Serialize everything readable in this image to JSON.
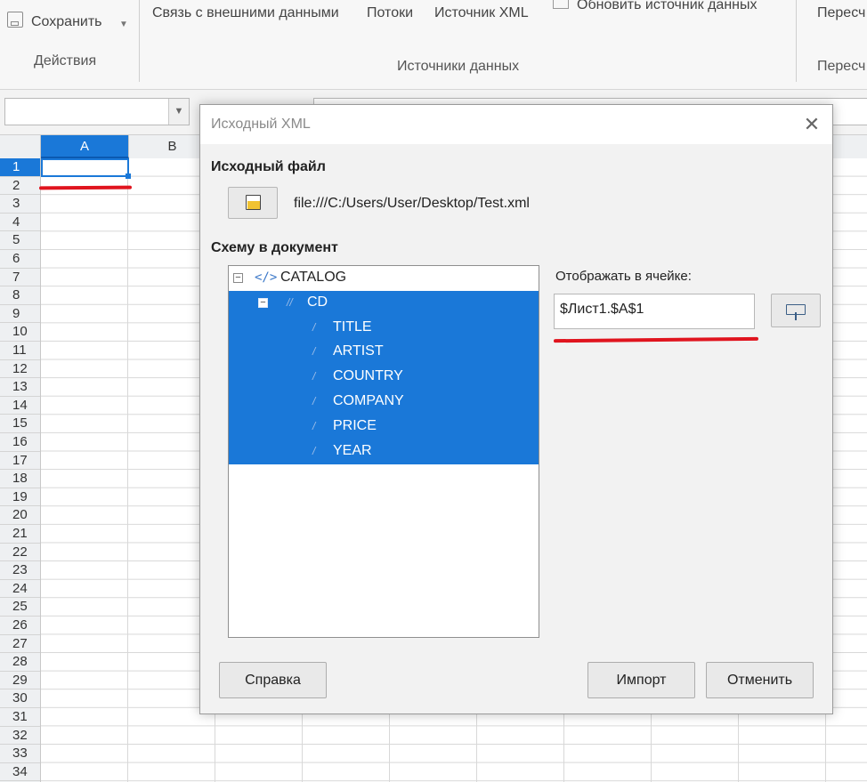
{
  "ribbon": {
    "save_label": "Сохранить",
    "actions_group": "Действия",
    "links_label": "Связь с внешними данными",
    "streams_label": "Потоки",
    "xml_source_label": "Источник XML",
    "refresh_label": "Обновить источник данных",
    "data_sources_group": "Источники данных",
    "recalc_label": "Пересч",
    "recalc_group": "Пересч"
  },
  "sheet": {
    "columns": [
      "A",
      "B"
    ],
    "rows": [
      "1",
      "2",
      "3",
      "4",
      "5",
      "6",
      "7",
      "8",
      "9",
      "10",
      "11",
      "12",
      "13",
      "14",
      "15",
      "16",
      "17",
      "18",
      "19",
      "20",
      "21",
      "22",
      "23",
      "24",
      "25",
      "26",
      "27",
      "28",
      "29",
      "30",
      "31",
      "32",
      "33",
      "34"
    ],
    "active_cell": "A1"
  },
  "dialog": {
    "title": "Исходный XML",
    "close_glyph": "✕",
    "source_file_heading": "Исходный файл",
    "file_path": "file:///C:/Users/User/Desktop/Test.xml",
    "schema_heading": "Схему в документ",
    "tree": [
      {
        "label": "CATALOG",
        "level": 0,
        "kind": "element",
        "expander": "−",
        "selected": false
      },
      {
        "label": "CD",
        "level": 1,
        "kind": "repeat",
        "expander": "−",
        "selected": true
      },
      {
        "label": "TITLE",
        "level": 2,
        "kind": "attribute",
        "selected": true
      },
      {
        "label": "ARTIST",
        "level": 2,
        "kind": "attribute",
        "selected": true
      },
      {
        "label": "COUNTRY",
        "level": 2,
        "kind": "attribute",
        "selected": true
      },
      {
        "label": "COMPANY",
        "level": 2,
        "kind": "attribute",
        "selected": true
      },
      {
        "label": "PRICE",
        "level": 2,
        "kind": "attribute",
        "selected": true
      },
      {
        "label": "YEAR",
        "level": 2,
        "kind": "attribute",
        "selected": true
      }
    ],
    "map_to_cell_label": "Отображать в ячейке:",
    "map_to_cell_value": "$Лист1.$A$1",
    "help_button": "Справка",
    "import_button": "Импорт",
    "cancel_button": "Отменить"
  },
  "colors": {
    "selection": "#1a78d8",
    "annotation_red": "#e0141e"
  }
}
